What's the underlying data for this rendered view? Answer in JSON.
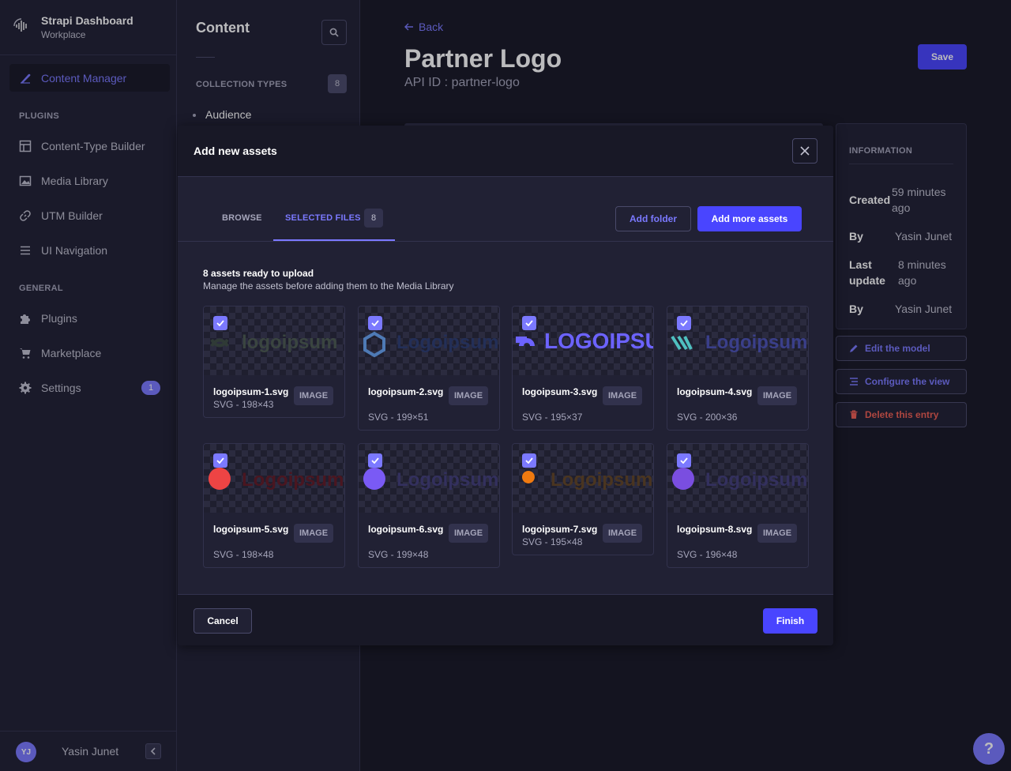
{
  "brand": {
    "title": "Strapi Dashboard",
    "subtitle": "Workplace"
  },
  "sidebar": {
    "primary": {
      "label": "Content Manager",
      "icon": "feather-icon"
    },
    "plugins_heading": "PLUGINS",
    "plugins": [
      {
        "label": "Content-Type Builder",
        "icon": "layout-icon"
      },
      {
        "label": "Media Library",
        "icon": "images-icon"
      },
      {
        "label": "UTM Builder",
        "icon": "link-icon"
      },
      {
        "label": "UI Navigation",
        "icon": "list-icon"
      }
    ],
    "general_heading": "GENERAL",
    "general": [
      {
        "label": "Plugins",
        "icon": "puzzle-icon"
      },
      {
        "label": "Marketplace",
        "icon": "cart-icon"
      },
      {
        "label": "Settings",
        "icon": "gear-icon",
        "badge": "1"
      }
    ],
    "user": {
      "initials": "YJ",
      "name": "Yasin Junet"
    }
  },
  "subnav": {
    "title": "Content",
    "section": "COLLECTION TYPES",
    "count": "8",
    "items": [
      "Audience"
    ]
  },
  "page": {
    "back": "Back",
    "title": "Partner Logo",
    "api_id": "API ID : partner-logo",
    "save": "Save"
  },
  "info": {
    "title": "INFORMATION",
    "rows": [
      {
        "key": "Created",
        "value": "59 minutes ago"
      },
      {
        "key": "By",
        "value": "Yasin Junet"
      },
      {
        "key": "Last update",
        "value": "8 minutes ago"
      },
      {
        "key": "By",
        "value": "Yasin Junet"
      }
    ],
    "actions": [
      {
        "label": "Edit the model",
        "icon": "pencil-icon",
        "color": "#7b79ff"
      },
      {
        "label": "Configure the view",
        "icon": "sliders-icon",
        "color": "#7b79ff"
      },
      {
        "label": "Delete this entry",
        "icon": "trash-icon",
        "color": "#ee5e52"
      }
    ]
  },
  "modal": {
    "title": "Add new assets",
    "tabs": {
      "browse": "BROWSE",
      "selected": "SELECTED FILES",
      "selected_count": "8"
    },
    "add_folder": "Add folder",
    "add_more": "Add more assets",
    "ready_title": "8 assets ready to upload",
    "ready_sub": "Manage the assets before adding them to the Media Library",
    "assets": [
      {
        "name": "logoipsum-1.svg",
        "meta": "SVG - 198×43",
        "type": "IMAGE",
        "logo_text": "logoipsum",
        "accent": "#2f3a36",
        "text_color": "#3a4540"
      },
      {
        "name": "logoipsum-2.svg",
        "meta": "SVG - 199×51",
        "type": "IMAGE",
        "logo_text": "Logoipsum",
        "accent": "#4e7ab5",
        "text_color": "#232f58"
      },
      {
        "name": "logoipsum-3.svg",
        "meta": "SVG - 195×37",
        "type": "IMAGE",
        "logo_text": "LOGOIPSUM",
        "accent": "#6c63ff",
        "text_color": "#6c63ff"
      },
      {
        "name": "logoipsum-4.svg",
        "meta": "SVG - 200×36",
        "type": "IMAGE",
        "logo_text": "Logoipsum",
        "accent": "#4fc0c0",
        "text_color": "#3a3f8a"
      },
      {
        "name": "logoipsum-5.svg",
        "meta": "SVG - 198×48",
        "type": "IMAGE",
        "logo_text": "Logoipsum",
        "accent": "#ee4444",
        "text_color": "#4a1620"
      },
      {
        "name": "logoipsum-6.svg",
        "meta": "SVG - 199×48",
        "type": "IMAGE",
        "logo_text": "Logoipsum",
        "accent": "#7a5af5",
        "text_color": "#33305e"
      },
      {
        "name": "logoipsum-7.svg",
        "meta": "SVG - 195×48",
        "type": "IMAGE",
        "logo_text": "Logoipsum",
        "accent": "#f07a10",
        "text_color": "#4a3520"
      },
      {
        "name": "logoipsum-8.svg",
        "meta": "SVG - 196×48",
        "type": "IMAGE",
        "logo_text": "Logoipsum",
        "accent": "#7a4ee0",
        "text_color": "#33305e"
      }
    ],
    "cancel": "Cancel",
    "finish": "Finish"
  },
  "help": "?"
}
